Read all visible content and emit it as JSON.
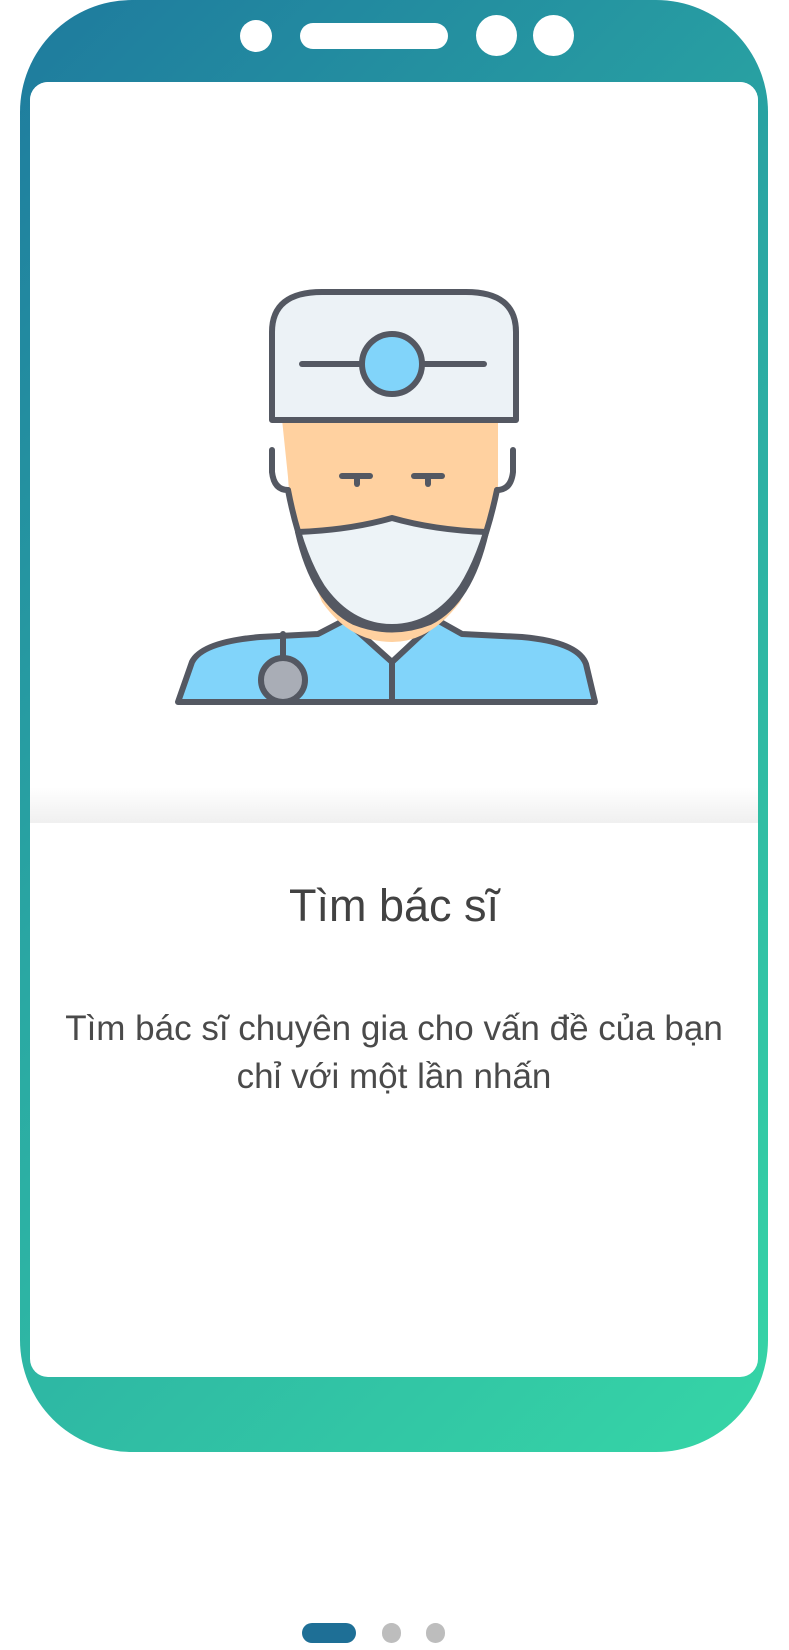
{
  "onboarding": {
    "title": "Tìm bác sĩ",
    "description": "Tìm bác sĩ chuyên gia cho vấn đề của bạn chỉ với một lần nhấn"
  },
  "pager": {
    "current_page": 1,
    "total_pages": 3
  },
  "colors": {
    "frame_start": "#1e7a9e",
    "frame_end": "#36d6a6",
    "active_dot": "#1e6f96",
    "inactive_dot": "#bdbdbd",
    "text": "#424242"
  },
  "icons": {
    "illustration": "doctor-with-head-mirror-icon"
  }
}
